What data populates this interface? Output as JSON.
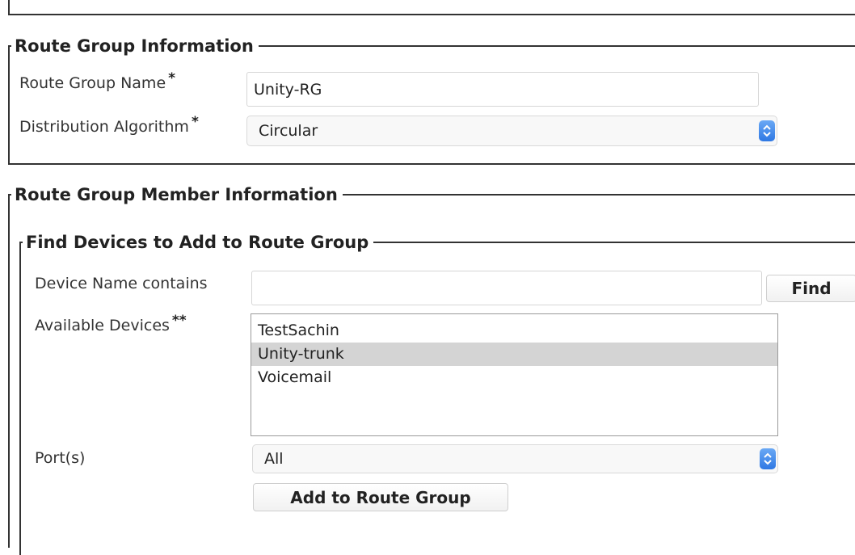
{
  "route_group_info": {
    "legend": "Route Group Information",
    "name_label": "Route Group Name",
    "name_required": "*",
    "name_value": "Unity-RG",
    "algorithm_label": "Distribution Algorithm",
    "algorithm_required": "*",
    "algorithm_value": "Circular"
  },
  "member_info": {
    "legend": "Route Group Member Information"
  },
  "find_devices": {
    "legend": "Find Devices to Add to Route Group",
    "device_name_label": "Device Name contains",
    "device_name_value": "",
    "find_button": "Find",
    "available_label": "Available Devices",
    "available_required": "**",
    "available_devices": [
      {
        "label": "TestSachin",
        "selected": false
      },
      {
        "label": "Unity-trunk",
        "selected": true
      },
      {
        "label": "Voicemail",
        "selected": false
      }
    ],
    "ports_label": "Port(s)",
    "ports_value": "All",
    "add_button": "Add to Route Group"
  },
  "icons": {
    "select_arrow": "chevron-updown-icon",
    "select_arrow_color": "#3d86ea"
  }
}
